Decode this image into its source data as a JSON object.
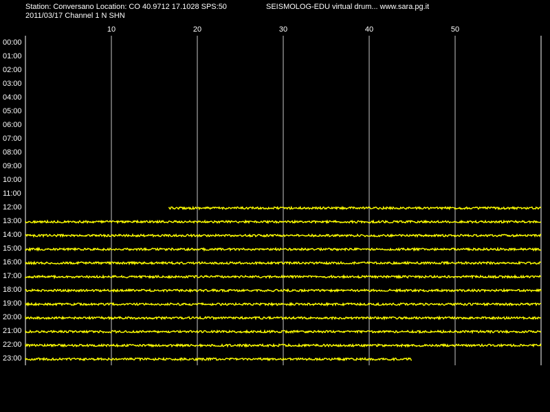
{
  "header": {
    "station_line": "Station: Conversano Location: CO 40.9712 17.1028 SPS:50",
    "date_line": "2011/03/17  Channel 1 N SHN",
    "title": "SEISMOLOG-EDU virtual drum... www.sara.pg.it"
  },
  "minute_ticks": [
    "10",
    "20",
    "30",
    "40",
    "50"
  ],
  "hour_labels": [
    "00:00",
    "01:00",
    "02:00",
    "03:00",
    "04:00",
    "05:00",
    "06:00",
    "07:00",
    "08:00",
    "09:00",
    "10:00",
    "11:00",
    "12:00",
    "13:00",
    "14:00",
    "15:00",
    "16:00",
    "17:00",
    "18:00",
    "19:00",
    "20:00",
    "21:00",
    "22:00",
    "23:00"
  ],
  "colors": {
    "background": "#000000",
    "axes": "#ffffff",
    "grid": "#c8c8c8",
    "trace": "#ffff00"
  },
  "traces": [
    {
      "hour": "12:00",
      "start_min": 16.7,
      "end_min": 60
    },
    {
      "hour": "13:00",
      "start_min": 0,
      "end_min": 60
    },
    {
      "hour": "14:00",
      "start_min": 0,
      "end_min": 60
    },
    {
      "hour": "15:00",
      "start_min": 0,
      "end_min": 60
    },
    {
      "hour": "16:00",
      "start_min": 0,
      "end_min": 60
    },
    {
      "hour": "17:00",
      "start_min": 0,
      "end_min": 60
    },
    {
      "hour": "18:00",
      "start_min": 0,
      "end_min": 60
    },
    {
      "hour": "19:00",
      "start_min": 0,
      "end_min": 60
    },
    {
      "hour": "20:00",
      "start_min": 0,
      "end_min": 60
    },
    {
      "hour": "21:00",
      "start_min": 0,
      "end_min": 60
    },
    {
      "hour": "22:00",
      "start_min": 0,
      "end_min": 60
    },
    {
      "hour": "23:00",
      "start_min": 0,
      "end_min": 45
    }
  ]
}
